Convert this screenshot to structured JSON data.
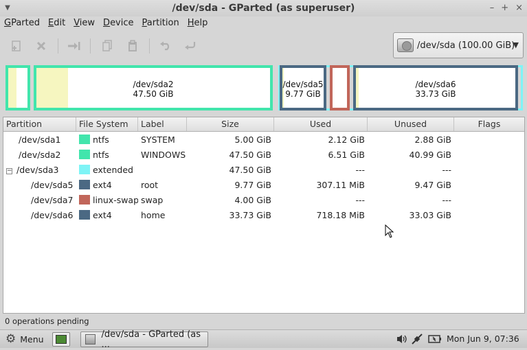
{
  "window": {
    "title": "/dev/sda - GParted (as superuser)",
    "controls": [
      "minimize",
      "maximize",
      "close"
    ]
  },
  "menubar": [
    {
      "label": "GParted",
      "mnemonic": "G"
    },
    {
      "label": "Edit",
      "mnemonic": "E"
    },
    {
      "label": "View",
      "mnemonic": "V"
    },
    {
      "label": "Device",
      "mnemonic": "D"
    },
    {
      "label": "Partition",
      "mnemonic": "P"
    },
    {
      "label": "Help",
      "mnemonic": "H"
    }
  ],
  "toolbar": {
    "buttons": [
      {
        "name": "new-partition",
        "icon": "new-icon",
        "enabled": false
      },
      {
        "name": "delete-partition",
        "icon": "delete-icon",
        "enabled": false
      },
      {
        "name": "resize-move",
        "icon": "resize-move-icon",
        "enabled": false
      },
      {
        "name": "copy",
        "icon": "copy-icon",
        "enabled": false
      },
      {
        "name": "paste",
        "icon": "paste-icon",
        "enabled": false
      },
      {
        "name": "undo",
        "icon": "undo-icon",
        "enabled": false
      },
      {
        "name": "apply",
        "icon": "apply-icon",
        "enabled": false
      }
    ]
  },
  "device_selector": {
    "label": "/dev/sda  (100.00 GiB)",
    "icon": "hard-disk-icon"
  },
  "disk_map": {
    "colors": {
      "ntfs": "#42e5ac",
      "extended": "#7ef4f6",
      "ext4": "#4b6983",
      "linux-swap": "#c1665a",
      "used": "#f6f6c0",
      "unused": "#ffffff"
    },
    "partitions": [
      {
        "name": "/dev/sda1",
        "size": "5.00 GiB",
        "fs": "ntfs",
        "used_fraction": 0.424,
        "label_visible": false
      },
      {
        "name": "/dev/sda2",
        "size": "47.50 GiB",
        "fs": "ntfs",
        "used_fraction": 0.137,
        "label_visible": true
      },
      {
        "name": "/dev/sda5",
        "size": "9.77 GiB",
        "fs": "ext4",
        "used_fraction": 0.031,
        "label_visible": true
      },
      {
        "name": "/dev/sda7",
        "size": "4.00 GiB",
        "fs": "linux-swap",
        "used_fraction": 0,
        "label_visible": false
      },
      {
        "name": "/dev/sda6",
        "size": "33.73 GiB",
        "fs": "ext4",
        "used_fraction": 0.021,
        "label_visible": true
      }
    ]
  },
  "table": {
    "columns": [
      "Partition",
      "File System",
      "Label",
      "Size",
      "Used",
      "Unused",
      "Flags"
    ],
    "rows": [
      {
        "partition": "/dev/sda1",
        "fs": "ntfs",
        "fs_color": "#42e5ac",
        "label": "SYSTEM",
        "size": "5.00 GiB",
        "used": "2.12 GiB",
        "unused": "2.88 GiB",
        "flags": "",
        "indent": 0,
        "expander": ""
      },
      {
        "partition": "/dev/sda2",
        "fs": "ntfs",
        "fs_color": "#42e5ac",
        "label": "WINDOWS",
        "size": "47.50 GiB",
        "used": "6.51 GiB",
        "unused": "40.99 GiB",
        "flags": "",
        "indent": 0,
        "expander": ""
      },
      {
        "partition": "/dev/sda3",
        "fs": "extended",
        "fs_color": "#7ef4f6",
        "label": "",
        "size": "47.50 GiB",
        "used": "---",
        "unused": "---",
        "flags": "",
        "indent": 0,
        "expander": "−"
      },
      {
        "partition": "/dev/sda5",
        "fs": "ext4",
        "fs_color": "#4b6983",
        "label": "root",
        "size": "9.77 GiB",
        "used": "307.11 MiB",
        "unused": "9.47 GiB",
        "flags": "",
        "indent": 1,
        "expander": ""
      },
      {
        "partition": "/dev/sda7",
        "fs": "linux-swap",
        "fs_color": "#c1665a",
        "label": "swap",
        "size": "4.00 GiB",
        "used": "---",
        "unused": "---",
        "flags": "",
        "indent": 1,
        "expander": ""
      },
      {
        "partition": "/dev/sda6",
        "fs": "ext4",
        "fs_color": "#4b6983",
        "label": "home",
        "size": "33.73 GiB",
        "used": "718.18 MiB",
        "unused": "33.03 GiB",
        "flags": "",
        "indent": 1,
        "expander": ""
      }
    ]
  },
  "statusbar": {
    "text": "0 operations pending"
  },
  "panel": {
    "menu_label": "Menu",
    "task_label": "/dev/sda - GParted (as ...",
    "clock": "Mon Jun  9, 07:36",
    "tray_icons": [
      "volume-icon",
      "network-icon",
      "battery-icon"
    ]
  }
}
